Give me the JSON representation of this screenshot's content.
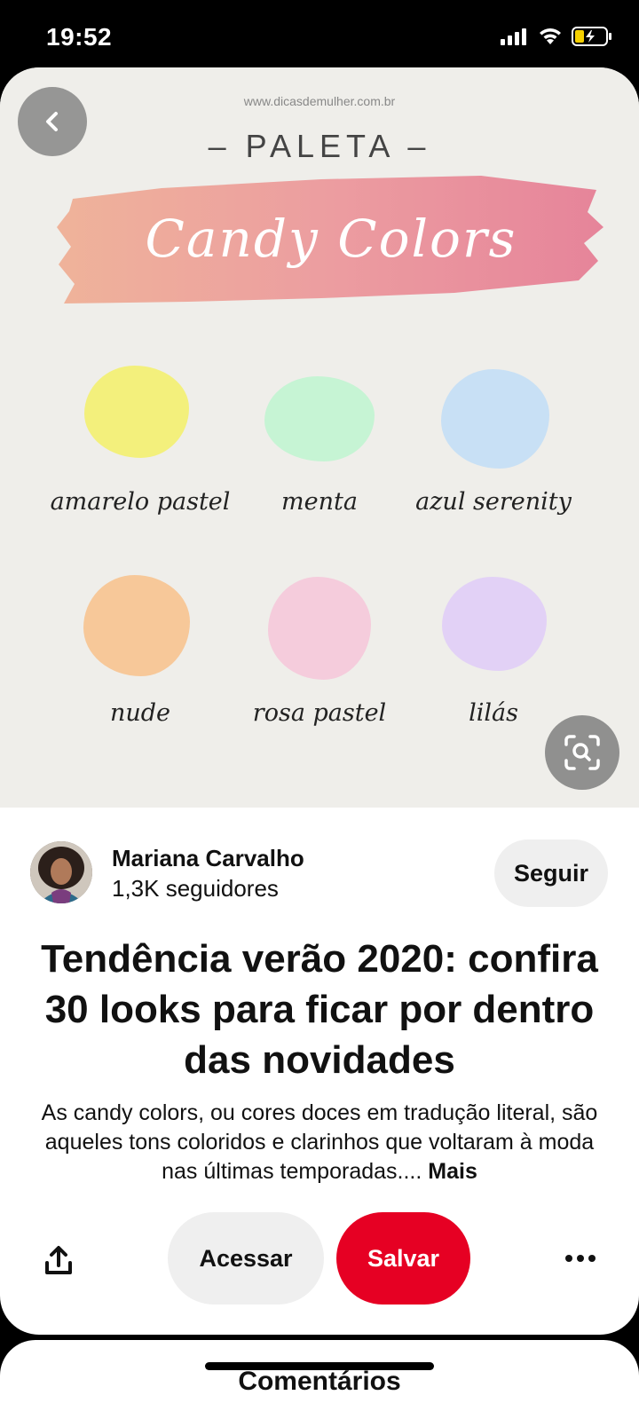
{
  "status_bar": {
    "time": "19:52"
  },
  "pin_image": {
    "site": "www.dicasdemulher.com.br",
    "heading": "– PALETA –",
    "script_title": "Candy Colors",
    "swatches": [
      {
        "label": "amarelo pastel",
        "color": "#f3f07c"
      },
      {
        "label": "menta",
        "color": "#c6f4d4"
      },
      {
        "label": "azul serenity",
        "color": "#c8e0f5"
      },
      {
        "label": "nude",
        "color": "#f7c899"
      },
      {
        "label": "rosa pastel",
        "color": "#f5ccdc"
      },
      {
        "label": "lilás",
        "color": "#e2d1f6"
      }
    ]
  },
  "author": {
    "name": "Mariana Carvalho",
    "followers": "1,3K seguidores",
    "follow_label": "Seguir"
  },
  "pin": {
    "title": "Tendência verão 2020: confira 30 looks para ficar por dentro das novidades",
    "description": "As candy colors, ou cores doces em tradução literal, são aqueles tons coloridos e clarinhos que voltaram à moda nas últimas temporadas....",
    "more_label": "Mais"
  },
  "actions": {
    "visit_label": "Acessar",
    "save_label": "Salvar"
  },
  "comments": {
    "title": "Comentários"
  },
  "colors": {
    "save_red": "#e60023",
    "button_gray": "#efefef",
    "image_bg": "#efeeea"
  }
}
